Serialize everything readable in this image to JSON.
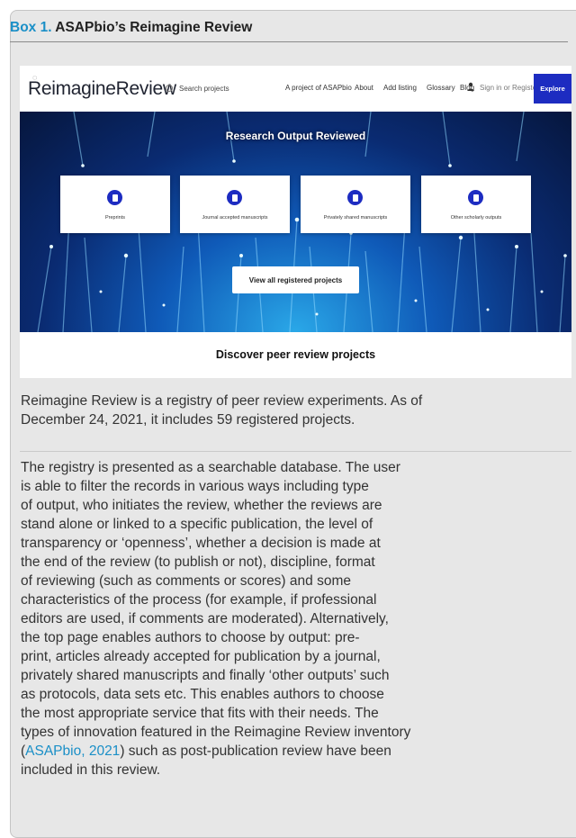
{
  "box": {
    "number": "Box 1.",
    "title": "ASAPbio’s Reimagine Review"
  },
  "screenshot": {
    "logo": "ReimagineReview",
    "search_placeholder": "Search projects",
    "nav": {
      "project_of": "A project of ASAPbio",
      "about": "About",
      "add_listing": "Add listing",
      "glossary": "Glossary",
      "blog": "Blog",
      "sign_in": "Sign in or Register",
      "explore": "Explore"
    },
    "hero_title": "Research Output Reviewed",
    "cards": [
      {
        "label": "Preprints",
        "icon": "document-icon"
      },
      {
        "label": "Journal accepted manuscripts",
        "icon": "document-check-icon"
      },
      {
        "label": "Privately shared manuscripts",
        "icon": "document-lock-icon"
      },
      {
        "label": "Other scholarly outputs",
        "icon": "dataset-icon"
      }
    ],
    "view_all": "View all registered projects",
    "discover": "Discover peer review projects"
  },
  "para1_lines": [
    "Reimagine Review is a registry of peer review experiments. As of",
    "December 24, 2021, it includes 59 registered projects."
  ],
  "para2_lines": [
    "The registry is presented as a searchable database. The user",
    "is able to filter the records in various ways including type",
    "of output, who initiates the review, whether the reviews are",
    "stand alone or linked to a specific publication, the level of",
    "transparency or ‘openness’, whether a decision is made at",
    "the end of the review (to publish or not), discipline, format",
    "of reviewing (such as comments or scores) and some",
    "characteristics of the process (for example, if professional",
    "editors are used, if comments are moderated). Alternatively,",
    "the top page enables authors to choose by output: pre-",
    "print, articles already accepted for publication by a journal,",
    "privately shared manuscripts and finally ‘other outputs’ such",
    "as protocols, data sets etc. This enables authors to choose",
    "the most appropriate service that fits with their needs. The",
    "types of innovation featured in the Reimagine Review inventory"
  ],
  "para2_link_line": {
    "open": "(",
    "link": "ASAPbio, 2021",
    "rest": ") such as post-publication review have been"
  },
  "para2_last_line": "included in this review.",
  "colors": {
    "accent": "#1a8fc7",
    "explore_button": "#1d2cc1"
  }
}
